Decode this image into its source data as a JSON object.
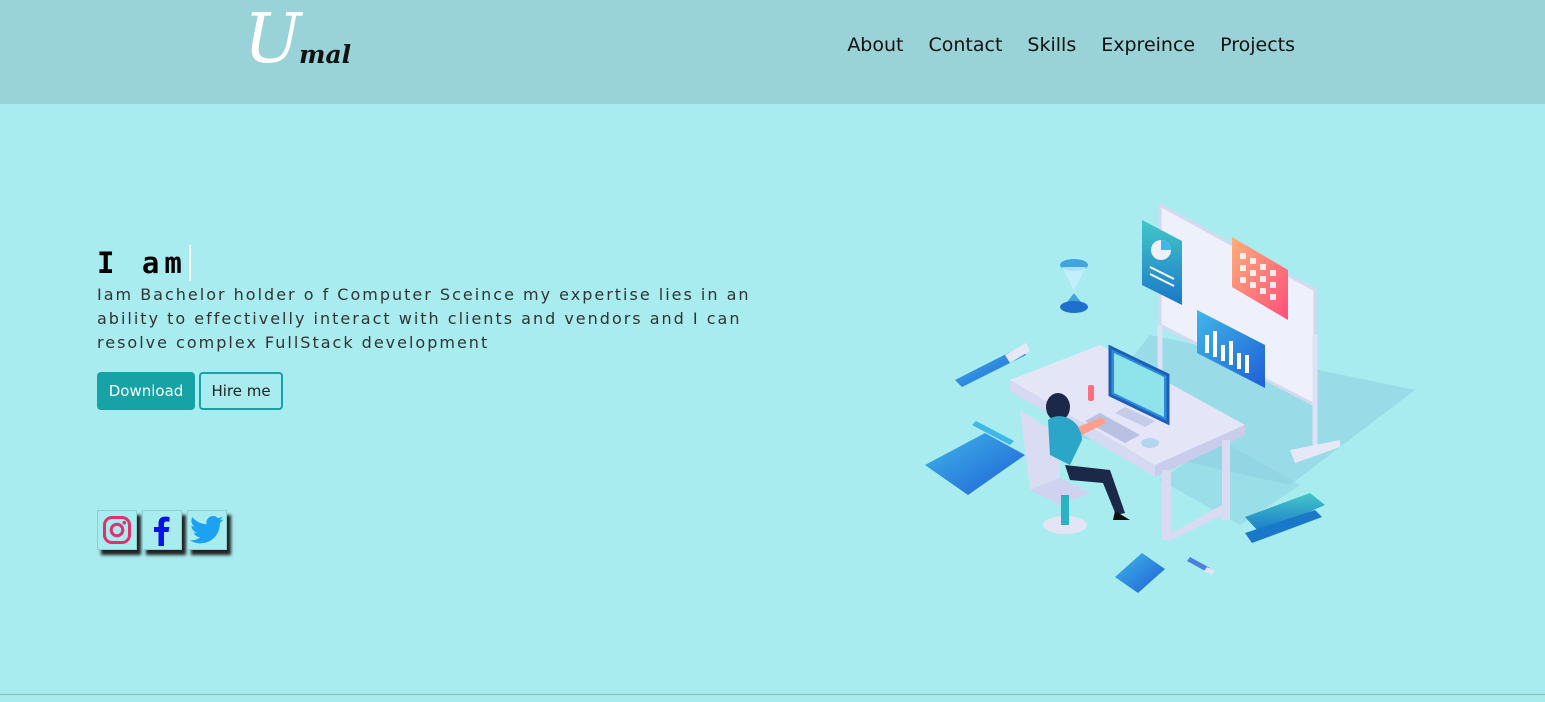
{
  "logo": {
    "initial": "U",
    "rest": "mal"
  },
  "nav": {
    "items": [
      {
        "label": "About"
      },
      {
        "label": "Contact"
      },
      {
        "label": "Skills"
      },
      {
        "label": "Expreince"
      },
      {
        "label": "Projects"
      }
    ]
  },
  "hero": {
    "title": "I am",
    "description": "Iam Bachelor holder o f Computer Sceince my expertise lies in an ability to effectivelly interact with clients and vendors and I can resolve complex FullStack development"
  },
  "buttons": {
    "download": "Download",
    "hire": "Hire me"
  },
  "social": [
    {
      "icon": "instagram-icon",
      "color": "#e1306c"
    },
    {
      "icon": "facebook-icon",
      "color": "#0a14e6"
    },
    {
      "icon": "twitter-icon",
      "color": "#1da1f2"
    }
  ],
  "colors": {
    "page_bg": "#a8ecef",
    "navbar_bg": "#99d3d7",
    "accent": "#17a2a6"
  }
}
